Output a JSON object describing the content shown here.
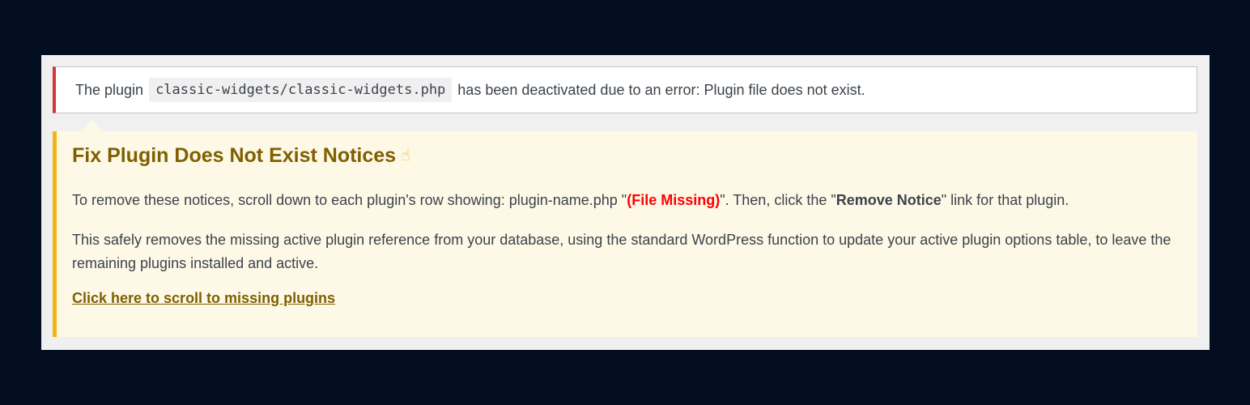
{
  "error_notice": {
    "prefix": "The plugin",
    "plugin_path": "classic-widgets/classic-widgets.php",
    "suffix": "has been deactivated due to an error: Plugin file does not exist.",
    "accent_color": "#d63638"
  },
  "fix_notice": {
    "title": "Fix Plugin Does Not Exist Notices",
    "title_icon": "pointing-hand-icon",
    "accent_color": "#f0b80e",
    "para1": {
      "text_a": "To remove these notices, scroll down to each plugin's row showing: plugin-name.php \"",
      "file_missing": "(File Missing)",
      "text_b": "\". Then, click the \"",
      "remove_notice": "Remove Notice",
      "text_c": "\" link for that plugin."
    },
    "para2": "This safely removes the missing active plugin reference from your database, using the standard WordPress function to update your active plugin options table, to leave the remaining plugins installed and active.",
    "link_label": "Click here to scroll to missing plugins"
  }
}
